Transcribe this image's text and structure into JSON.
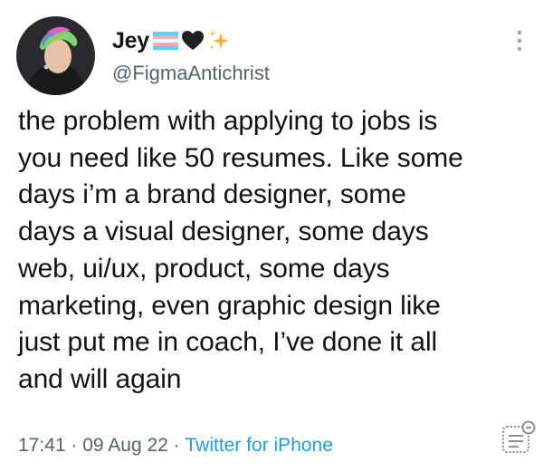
{
  "user": {
    "display_name": "Jey",
    "handle": "@FigmaAntichrist",
    "name_emojis": [
      "trans-flag-icon",
      "black-heart-icon",
      "sparkles-icon"
    ]
  },
  "tweet": {
    "text": "the problem with applying to jobs is\nyou need like 50 resumes. Like some\ndays i’m a brand designer, some\ndays a visual designer, some days\nweb, ui/ux, product, some days\nmarketing, even graphic design like\njust put me in coach, I’ve done it all\nand will again"
  },
  "meta": {
    "time": "17:41",
    "separator": " · ",
    "date": "09 Aug 22",
    "source": "Twitter for iPhone"
  },
  "colors": {
    "text": "#0f1419",
    "secondary": "#536471",
    "accent": "#1d9bf0",
    "trans_blue": "#5bcefa",
    "trans_pink": "#f5a9b8",
    "sparkle": "#ffac33"
  }
}
